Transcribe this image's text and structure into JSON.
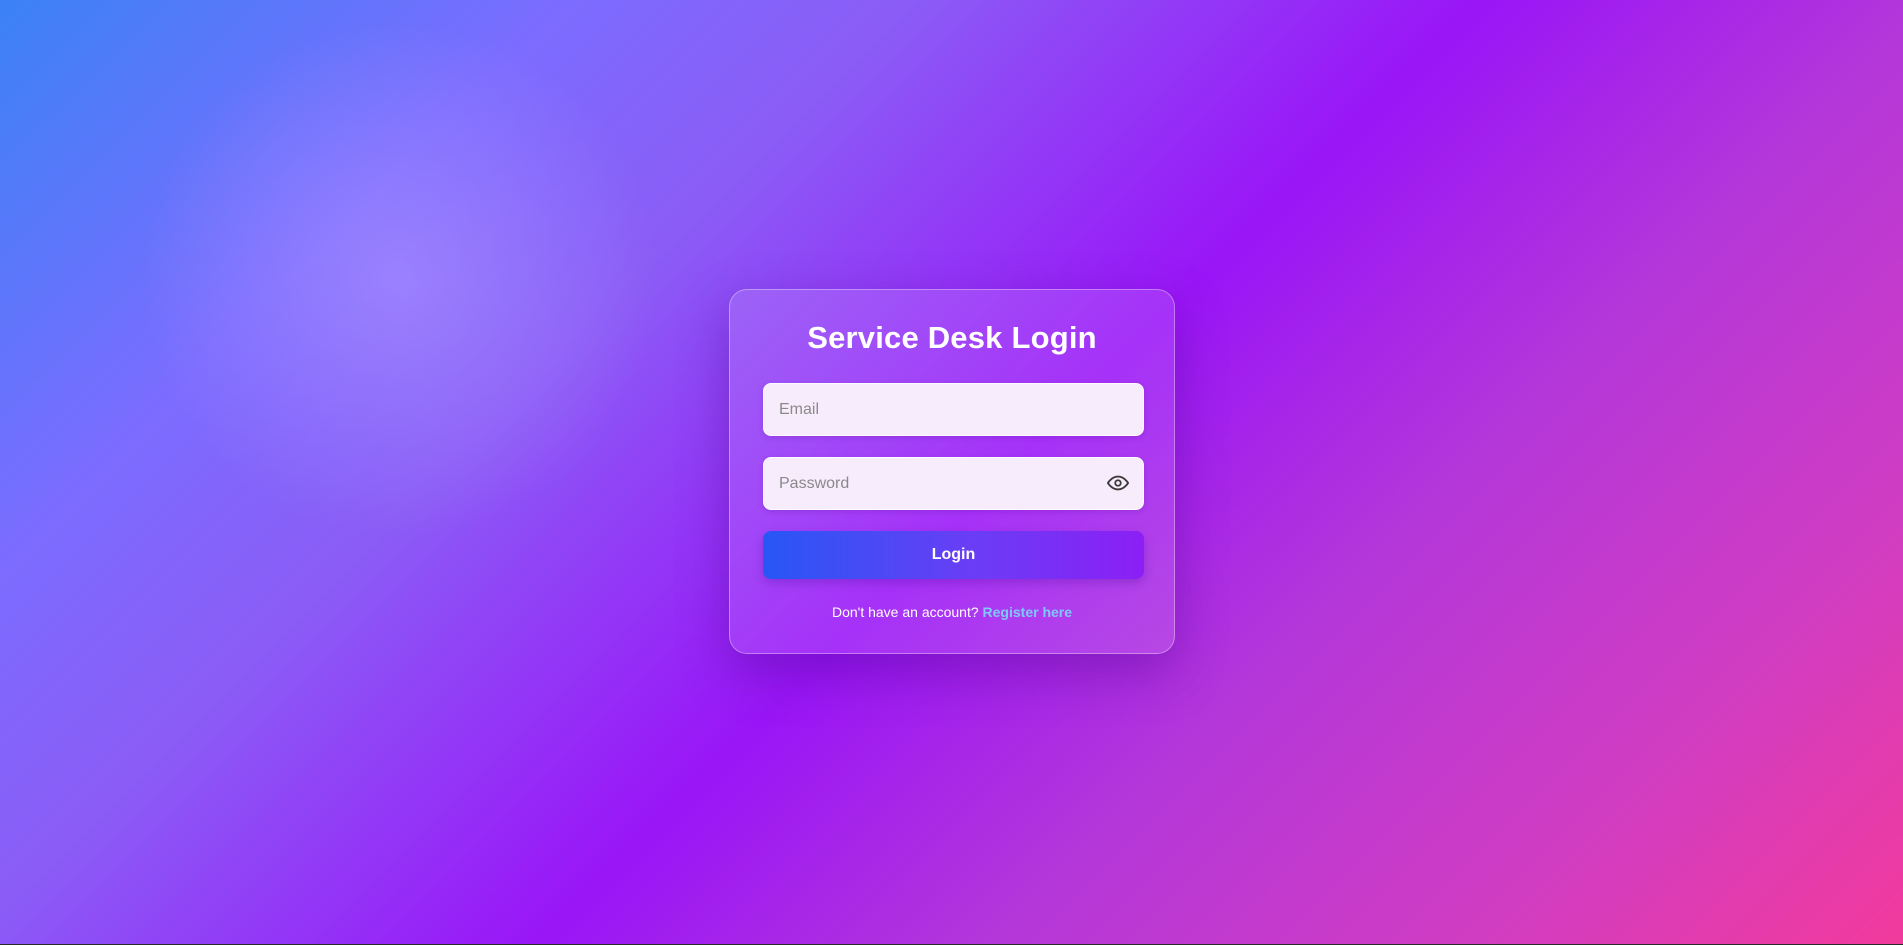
{
  "login": {
    "title": "Service Desk Login",
    "email_placeholder": "Email",
    "password_placeholder": "Password",
    "password_toggle_icon": "eye-icon",
    "submit_label": "Login",
    "footer_prompt": "Don't have an account?",
    "register_link": "Register here"
  },
  "colors": {
    "accent_link": "#7fc8ff",
    "button_start": "#2757f5",
    "button_end": "#8b1ff5",
    "background_start": "#3b82f6",
    "background_mid": "#9a15f7",
    "background_end": "#f23a9c"
  }
}
